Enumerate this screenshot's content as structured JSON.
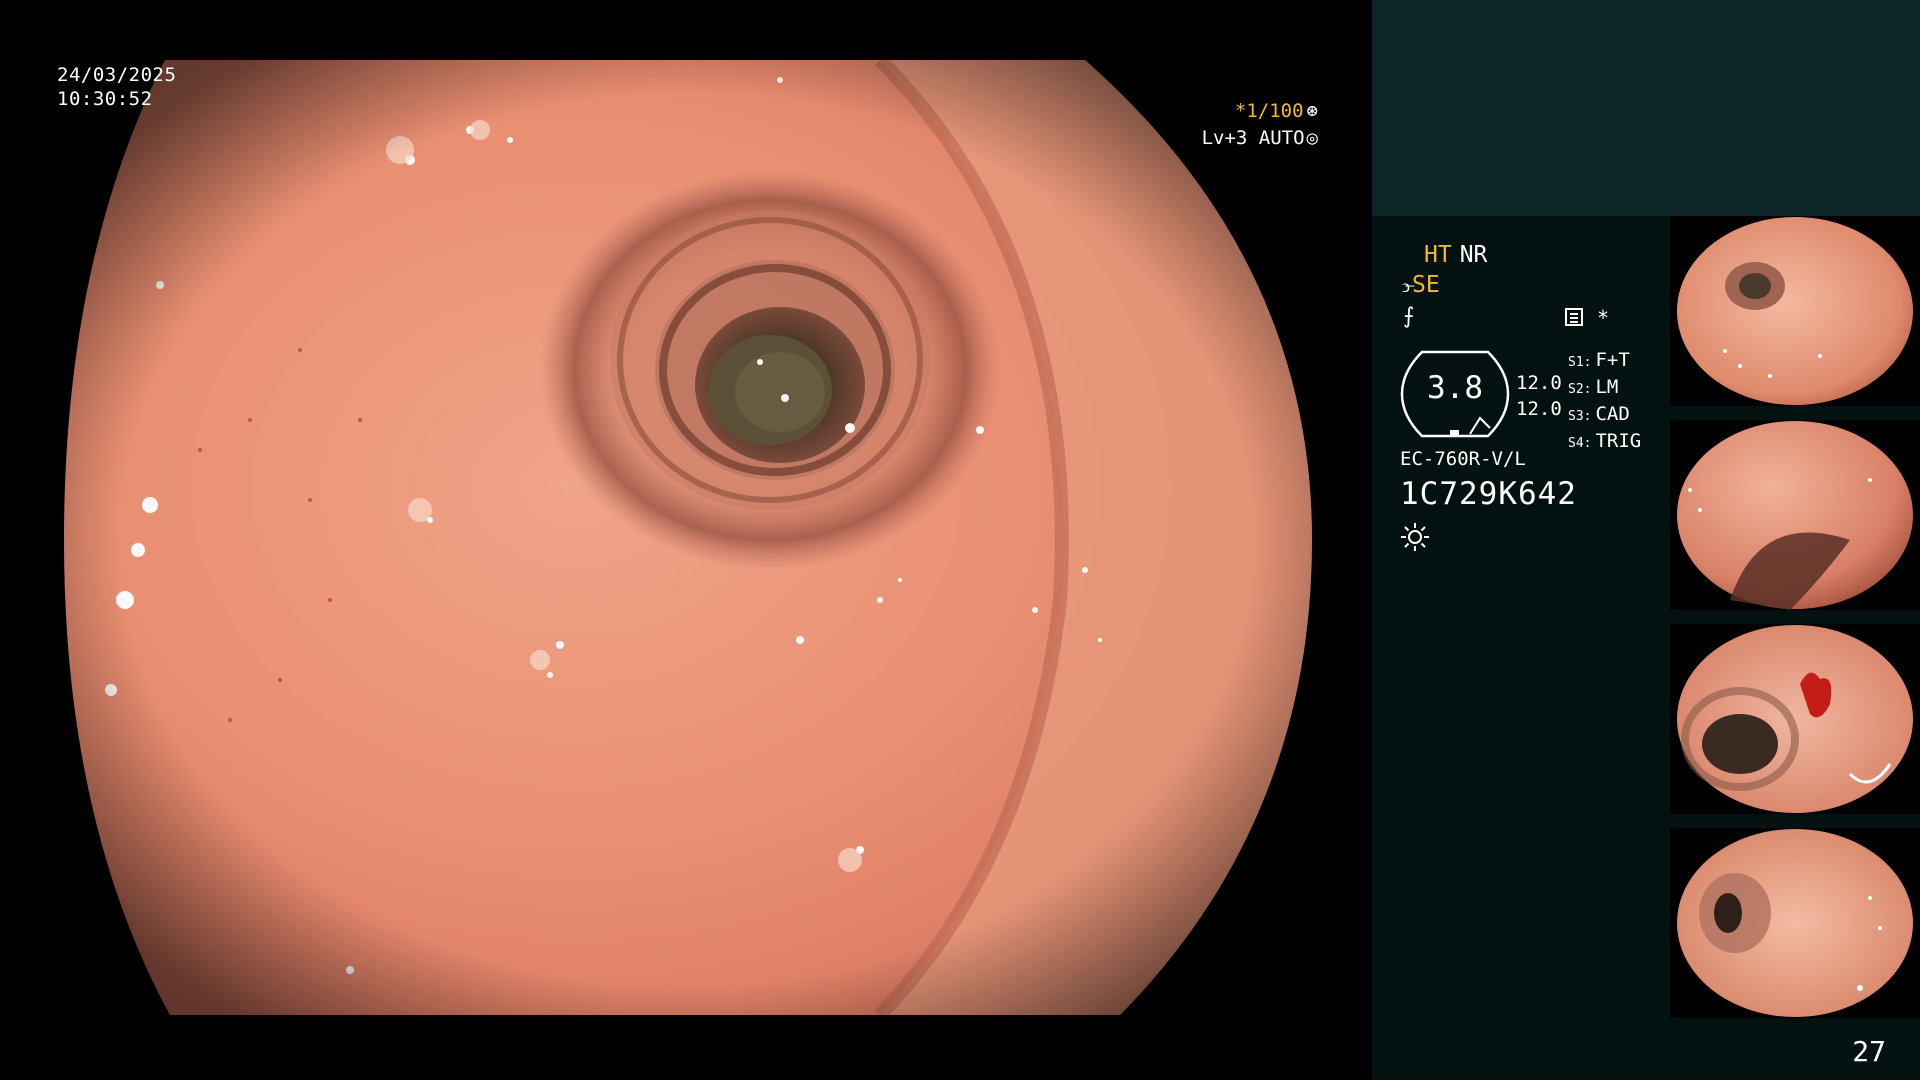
{
  "overlay": {
    "date": "24/03/2025",
    "time": "10:30:52",
    "shutter": "*1/100",
    "shutter_icon": "shutter-icon",
    "level": "Lv+3 AUTO",
    "level_icon": "iris-icon"
  },
  "panel": {
    "mode_ht": "HT",
    "mode_nr": "NR",
    "se_label": "SE",
    "se_icon": "structure-enhancement-icon",
    "freeze_icon": "freeze-icon",
    "record_icon": "record-icon",
    "asterisk": "*",
    "gauge_value": "3.8",
    "param1": "12.0",
    "param2": "12.0",
    "s_items": [
      {
        "key": "S1:",
        "value": "F+T"
      },
      {
        "key": "S2:",
        "value": "LM"
      },
      {
        "key": "S3:",
        "value": "CAD"
      },
      {
        "key": "S4:",
        "value": "TRIG"
      }
    ],
    "scope_model": "EC-760R-V/L",
    "scope_serial": "1C729K642",
    "brightness_icon": "sun-icon",
    "page_number": "27"
  },
  "colors": {
    "accent": "#f2b830",
    "panel_bg": "#031210",
    "panel_header": "#0f2628",
    "mucosa": "#e0866a"
  }
}
